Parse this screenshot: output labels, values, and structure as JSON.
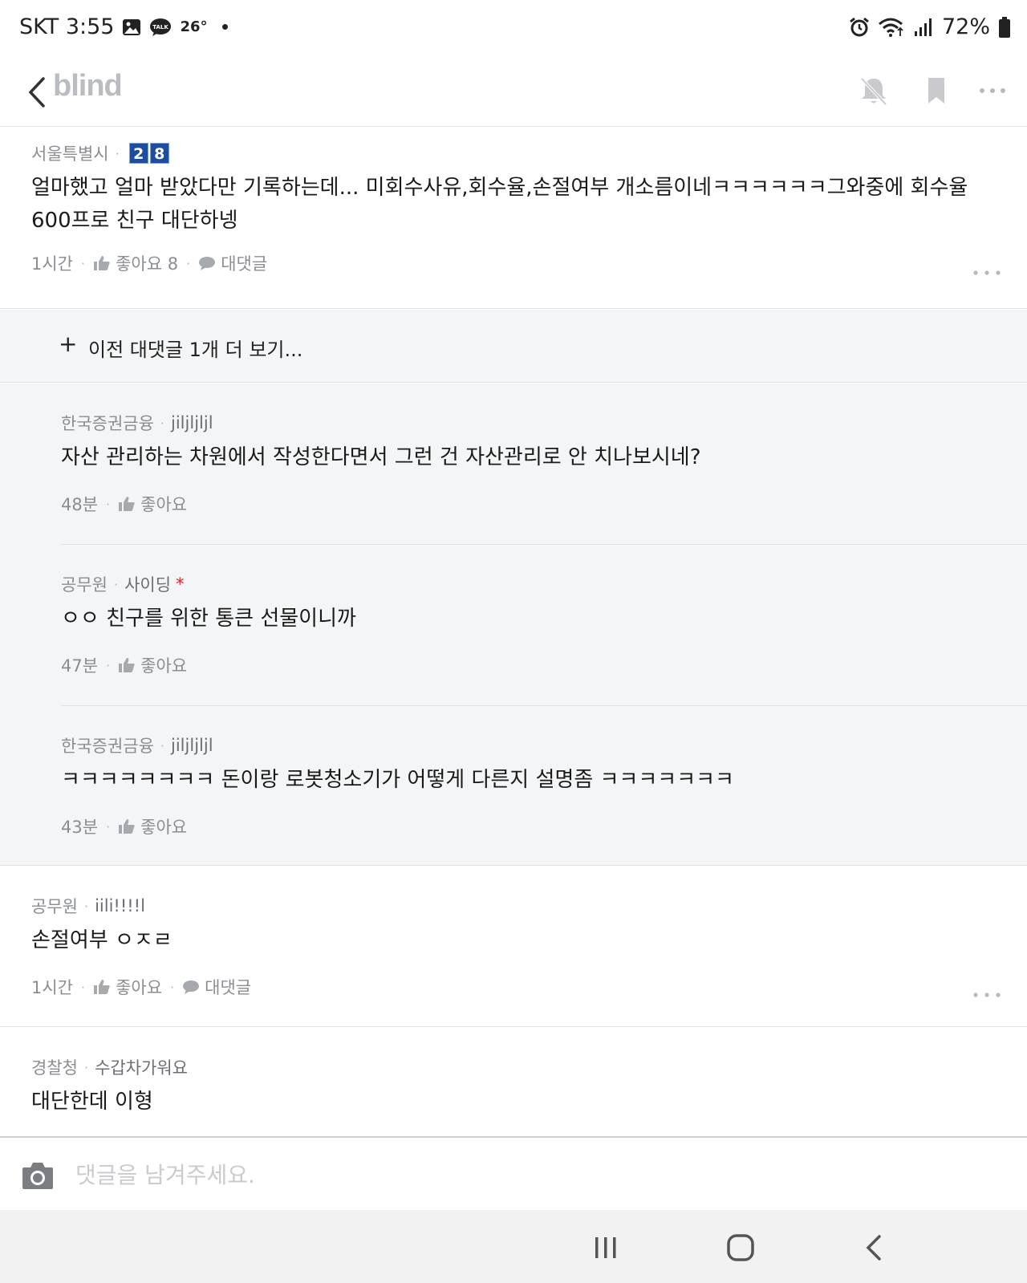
{
  "status": {
    "carrier_time": "SKT 3:55",
    "temp": "26°",
    "talk_label": "TALK",
    "battery": "72%"
  },
  "header": {
    "brand": "blind"
  },
  "comments": [
    {
      "company": "서울특별시",
      "badge": [
        "2",
        "8"
      ],
      "text": "얼마했고 얼마 받았다만 기록하는데... 미회수사유,회수율,손절여부 개소름이네ㅋㅋㅋㅋㅋㅋ그와중에 회수율 600프로 친구 대단하넹",
      "time": "1시간",
      "like_label": "좋아요 8",
      "reply_label": "대댓글"
    }
  ],
  "more_replies": {
    "plus": "+",
    "label": "이전 대댓글 1개 더 보기..."
  },
  "replies": [
    {
      "company": "한국증권금융",
      "nick": "jiljljljl",
      "text": "자산 관리하는 차원에서 작성한다면서 그런 건 자산관리로 안 치나보시네?",
      "time": "48분",
      "like_label": "좋아요"
    },
    {
      "company": "공무원",
      "nick": "사이딩",
      "star": "*",
      "text": "ㅇㅇ 친구를 위한 통큰 선물이니까",
      "time": "47분",
      "like_label": "좋아요"
    },
    {
      "company": "한국증권금융",
      "nick": "jiljljljl",
      "text": "ㅋㅋㅋㅋㅋㅋㅋㅋ 돈이랑 로봇청소기가 어떻게 다른지 설명좀 ㅋㅋㅋㅋㅋㅋㅋ",
      "time": "43분",
      "like_label": "좋아요"
    }
  ],
  "comment2": {
    "company": "공무원",
    "nick": "iili!!!!l",
    "text": "손절여부 ㅇㅈㄹ",
    "time": "1시간",
    "like_label": "좋아요",
    "reply_label": "대댓글"
  },
  "comment3": {
    "company": "경찰청",
    "nick": "수갑차가워요",
    "text": "대단한데 이형"
  },
  "input": {
    "placeholder": "댓글을 남겨주세요."
  },
  "icons": {
    "back": "chevron-left-icon",
    "bell_off": "bell-off-icon",
    "bookmark": "bookmark-icon",
    "more": "more-horizontal-icon",
    "like": "thumbs-up-icon",
    "reply": "speech-bubble-icon",
    "camera": "camera-icon"
  }
}
